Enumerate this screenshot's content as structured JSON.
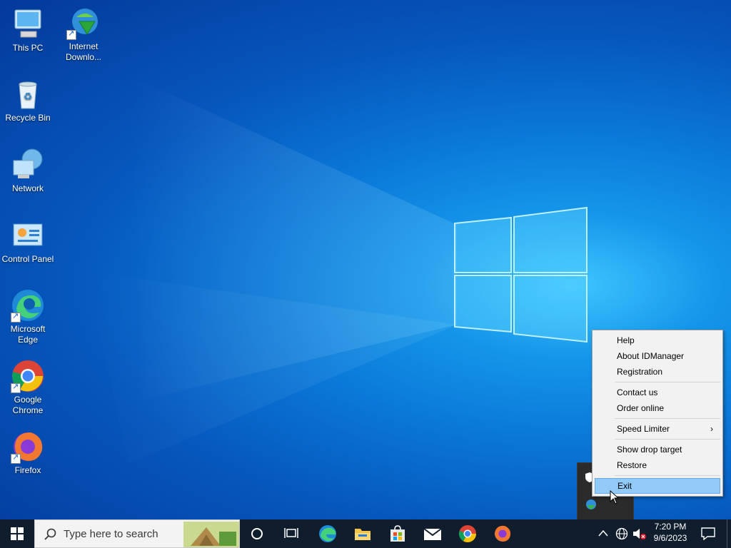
{
  "desktop": {
    "icons": [
      {
        "label": "This PC",
        "icon": "this-pc-icon"
      },
      {
        "label": "Internet\nDownlo...",
        "icon": "internet-download-manager-icon"
      },
      {
        "label": "Recycle Bin",
        "icon": "recycle-bin-icon"
      },
      {
        "label": "Network",
        "icon": "network-icon"
      },
      {
        "label": "Control Panel",
        "icon": "control-panel-icon"
      },
      {
        "label": "Microsoft\nEdge",
        "icon": "edge-icon"
      },
      {
        "label": "Google\nChrome",
        "icon": "chrome-icon"
      },
      {
        "label": "Firefox",
        "icon": "firefox-icon"
      }
    ]
  },
  "context_menu": {
    "items": [
      {
        "label": "Help"
      },
      {
        "label": "About IDManager"
      },
      {
        "label": "Registration"
      },
      {
        "label": "Contact us"
      },
      {
        "label": "Order online"
      },
      {
        "label": "Speed Limiter",
        "submenu_arrow": "›"
      },
      {
        "label": "Show drop target"
      },
      {
        "label": "Restore"
      },
      {
        "label": "Exit",
        "selected": true
      }
    ]
  },
  "taskbar": {
    "search_placeholder": "Type here to search",
    "clock_time": "7:20 PM",
    "clock_date": "9/6/2023",
    "pinned": [
      "task-view-icon",
      "edge-icon",
      "file-explorer-icon",
      "microsoft-store-icon",
      "mail-icon",
      "chrome-icon",
      "firefox-icon"
    ]
  },
  "colors": {
    "taskbar_bg": "#101d2c",
    "menu_bg": "#f2f2f2",
    "menu_selected": "#91c9f7",
    "desktop_accent": "#0a78d8"
  }
}
